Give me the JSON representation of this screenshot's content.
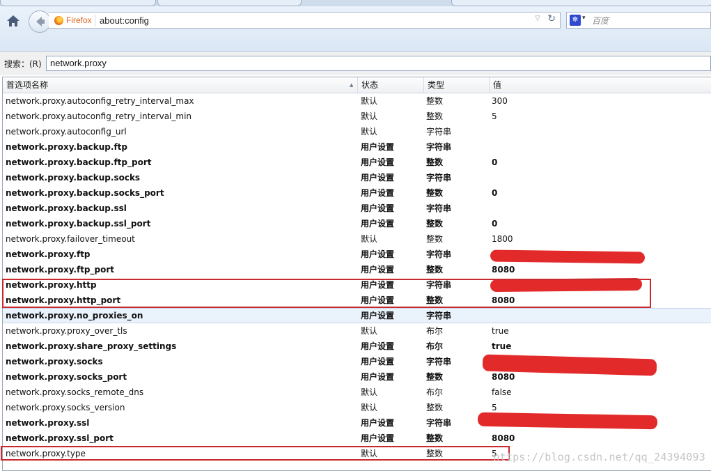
{
  "browser": {
    "brand_label": "Firefox",
    "url": "about:config",
    "search_placeholder": "百度"
  },
  "filter": {
    "label": "搜索：(R)",
    "value": "network.proxy"
  },
  "columns": {
    "name": "首选项名称",
    "status": "状态",
    "type": "类型",
    "value": "值"
  },
  "rows": [
    {
      "name": "network.proxy.autoconfig_retry_interval_max",
      "status": "默认",
      "type": "整数",
      "value": "300",
      "bold": false
    },
    {
      "name": "network.proxy.autoconfig_retry_interval_min",
      "status": "默认",
      "type": "整数",
      "value": "5",
      "bold": false
    },
    {
      "name": "network.proxy.autoconfig_url",
      "status": "默认",
      "type": "字符串",
      "value": "",
      "bold": false
    },
    {
      "name": "network.proxy.backup.ftp",
      "status": "用户设置",
      "type": "字符串",
      "value": "",
      "bold": true
    },
    {
      "name": "network.proxy.backup.ftp_port",
      "status": "用户设置",
      "type": "整数",
      "value": "0",
      "bold": true
    },
    {
      "name": "network.proxy.backup.socks",
      "status": "用户设置",
      "type": "字符串",
      "value": "",
      "bold": true
    },
    {
      "name": "network.proxy.backup.socks_port",
      "status": "用户设置",
      "type": "整数",
      "value": "0",
      "bold": true
    },
    {
      "name": "network.proxy.backup.ssl",
      "status": "用户设置",
      "type": "字符串",
      "value": "",
      "bold": true
    },
    {
      "name": "network.proxy.backup.ssl_port",
      "status": "用户设置",
      "type": "整数",
      "value": "0",
      "bold": true
    },
    {
      "name": "network.proxy.failover_timeout",
      "status": "默认",
      "type": "整数",
      "value": "1800",
      "bold": false
    },
    {
      "name": "network.proxy.ftp",
      "status": "用户设置",
      "type": "字符串",
      "value": "",
      "bold": true
    },
    {
      "name": "network.proxy.ftp_port",
      "status": "用户设置",
      "type": "整数",
      "value": "8080",
      "bold": true
    },
    {
      "name": "network.proxy.http",
      "status": "用户设置",
      "type": "字符串",
      "value": "",
      "bold": true
    },
    {
      "name": "network.proxy.http_port",
      "status": "用户设置",
      "type": "整数",
      "value": "8080",
      "bold": true
    },
    {
      "name": "network.proxy.no_proxies_on",
      "status": "用户设置",
      "type": "字符串",
      "value": "",
      "bold": true
    },
    {
      "name": "network.proxy.proxy_over_tls",
      "status": "默认",
      "type": "布尔",
      "value": "true",
      "bold": false
    },
    {
      "name": "network.proxy.share_proxy_settings",
      "status": "用户设置",
      "type": "布尔",
      "value": "true",
      "bold": true
    },
    {
      "name": "network.proxy.socks",
      "status": "用户设置",
      "type": "字符串",
      "value": "",
      "bold": true
    },
    {
      "name": "network.proxy.socks_port",
      "status": "用户设置",
      "type": "整数",
      "value": "8080",
      "bold": true
    },
    {
      "name": "network.proxy.socks_remote_dns",
      "status": "默认",
      "type": "布尔",
      "value": "false",
      "bold": false
    },
    {
      "name": "network.proxy.socks_version",
      "status": "默认",
      "type": "整数",
      "value": "5",
      "bold": false
    },
    {
      "name": "network.proxy.ssl",
      "status": "用户设置",
      "type": "字符串",
      "value": "",
      "bold": true
    },
    {
      "name": "network.proxy.ssl_port",
      "status": "用户设置",
      "type": "整数",
      "value": "8080",
      "bold": true
    },
    {
      "name": "network.proxy.type",
      "status": "默认",
      "type": "整数",
      "value": "5",
      "bold": false
    }
  ],
  "watermark": "https://blog.csdn.net/qq_24394093",
  "colors": {
    "redaction": "#e11a1a",
    "highlight_box": "#c9282d",
    "firefox_label": "#e0661b"
  }
}
